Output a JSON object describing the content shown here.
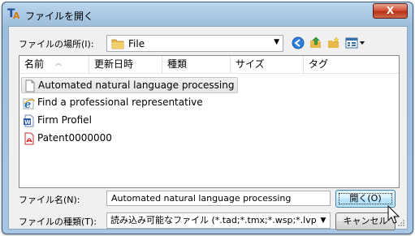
{
  "window": {
    "title": "ファイルを開く",
    "close_label": "X"
  },
  "look_in": {
    "label": "ファイルの場所(I):",
    "value": "File"
  },
  "toolbar": {
    "back_icon": "back-icon",
    "up_icon": "up-folder-icon",
    "new_folder_icon": "new-folder-icon",
    "views_icon": "views-menu-icon"
  },
  "columns": [
    "名前",
    "更新日時",
    "種類",
    "サイズ",
    "タグ"
  ],
  "files": [
    {
      "name": "Automated natural language processing",
      "icon": "document-icon",
      "selected": true
    },
    {
      "name": "Find a professional representative",
      "icon": "internet-explorer-icon",
      "selected": false
    },
    {
      "name": "Firm Profiel",
      "icon": "word-document-icon",
      "selected": false
    },
    {
      "name": "Patent0000000",
      "icon": "pdf-icon",
      "selected": false
    }
  ],
  "filename": {
    "label": "ファイル名(N):",
    "value": "Automated natural language processing"
  },
  "filetype": {
    "label": "ファイルの種類(T):",
    "value": "読み込み可能なファイル (*.tad;*.tmx;*.wsp;*.lvp;*.l"
  },
  "buttons": {
    "open": "開く(O)",
    "cancel": "キャンセル"
  },
  "colors": {
    "title_gradient_top": "#bcd6ee",
    "title_gradient_bottom": "#9cbddb",
    "close_red": "#c8442a",
    "client_bg": "#f0f0f0",
    "default_button_border": "#3c7fb1"
  }
}
